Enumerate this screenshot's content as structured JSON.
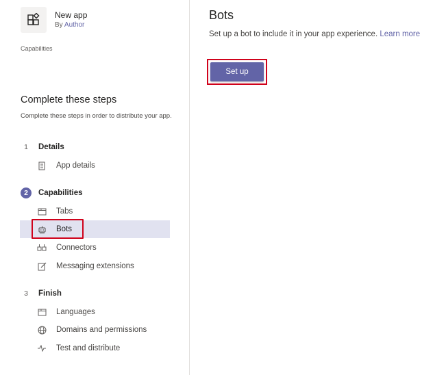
{
  "app": {
    "name": "New app",
    "author_prefix": "By",
    "author_link": "Author",
    "breadcrumb": "Capabilities"
  },
  "steps": {
    "title": "Complete these steps",
    "description": "Complete these steps in order to distribute your app.",
    "sections": [
      {
        "number": "1",
        "label": "Details",
        "items": [
          {
            "label": "App details",
            "icon": "document-icon"
          }
        ]
      },
      {
        "number": "2",
        "label": "Capabilities",
        "items": [
          {
            "label": "Tabs",
            "icon": "tab-icon"
          },
          {
            "label": "Bots",
            "icon": "bot-icon"
          },
          {
            "label": "Connectors",
            "icon": "connector-icon"
          },
          {
            "label": "Messaging extensions",
            "icon": "edit-icon"
          }
        ]
      },
      {
        "number": "3",
        "label": "Finish",
        "items": [
          {
            "label": "Languages",
            "icon": "language-icon"
          },
          {
            "label": "Domains and permissions",
            "icon": "globe-icon"
          },
          {
            "label": "Test and distribute",
            "icon": "pulse-icon"
          }
        ]
      }
    ]
  },
  "main": {
    "title": "Bots",
    "description": "Set up a bot to include it in your app experience.",
    "learn_more": "Learn more",
    "setup_button": "Set up"
  },
  "colors": {
    "accent": "#6264a7",
    "highlight": "#d0021b",
    "selected_bg": "#e1e2f0"
  }
}
